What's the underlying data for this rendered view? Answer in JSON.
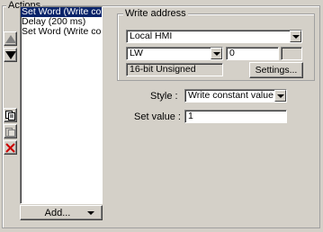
{
  "actions": {
    "title": "Actions",
    "items": [
      {
        "label": "Set Word (Write constant value)",
        "selected": true
      },
      {
        "label": "Delay (200 ms)",
        "selected": false
      },
      {
        "label": "Set Word (Write constant value)",
        "selected": false
      }
    ],
    "add_label": "Add...",
    "buttons": {
      "move_up_icon": "arrow-up-icon",
      "move_down_icon": "arrow-down-icon",
      "copy_icon": "copy-icon",
      "paste_icon": "paste-icon",
      "delete_icon": "delete-icon"
    }
  },
  "write_address": {
    "title": "Write address",
    "device": "Local HMI",
    "register_type": "LW",
    "address": "0",
    "extra_value": "",
    "data_format": "16-bit Unsigned",
    "settings_label": "Settings..."
  },
  "style": {
    "label": "Style :",
    "value": "Write constant value"
  },
  "set_value": {
    "label": "Set value :",
    "value": "1"
  },
  "colors": {
    "face": "#d4d0c8",
    "selection": "#0a246a",
    "delete_red": "#cc0000"
  }
}
